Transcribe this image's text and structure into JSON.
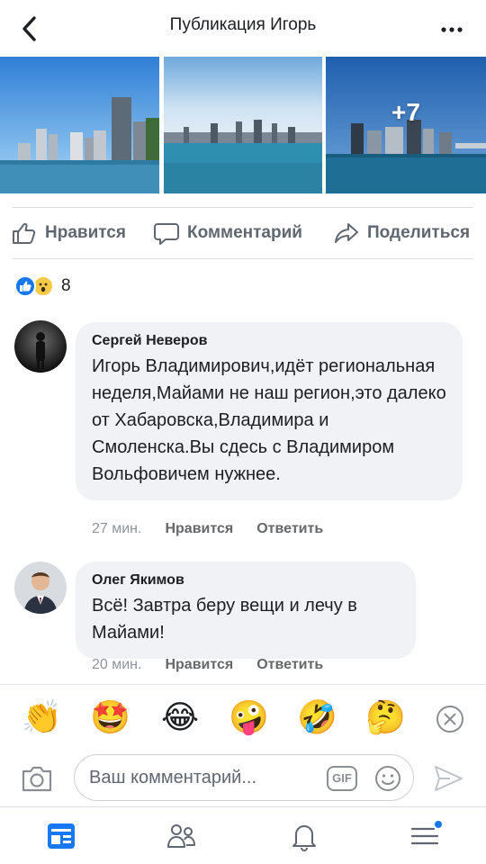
{
  "header": {
    "title": "Публикация Игорь",
    "back_icon": "chevron-left-icon",
    "more_icon": "more-horizontal-icon"
  },
  "photos": {
    "more_count": "+7"
  },
  "actions": {
    "like_label": "Нравится",
    "comment_label": "Комментарий",
    "share_label": "Поделиться"
  },
  "reactions": {
    "count": "8",
    "icons": [
      "like-reaction-icon",
      "wow-reaction-icon"
    ]
  },
  "comments": [
    {
      "author": "Сергей Неверов",
      "text": "Игорь Владимирович,идёт региональная неделя,Майами не наш регион,это далеко от Хабаровска,Владимира и Смоленска.Вы сдесь с Владимиром Вольфовичем нужнее.",
      "time": "27 мин.",
      "like_label": "Нравится",
      "reply_label": "Ответить"
    },
    {
      "author": "Олег Якимов",
      "text": "Всё! Завтра беру вещи и лечу в Майами!",
      "time": "20 мин.",
      "like_label": "Нравится",
      "reply_label": "Ответить"
    }
  ],
  "emoji_bar": {
    "emojis": [
      "👏",
      "🤩",
      "😂",
      "🤪",
      "🤣",
      "🤔"
    ]
  },
  "composer": {
    "placeholder": "Ваш комментарий...",
    "gif_label": "GIF"
  },
  "nav": {
    "items": [
      "feed-icon",
      "friends-icon",
      "notifications-bell-icon",
      "menu-icon"
    ]
  },
  "colors": {
    "brand": "#1877f2",
    "text_secondary": "#606770",
    "bubble": "#f0f2f5"
  }
}
